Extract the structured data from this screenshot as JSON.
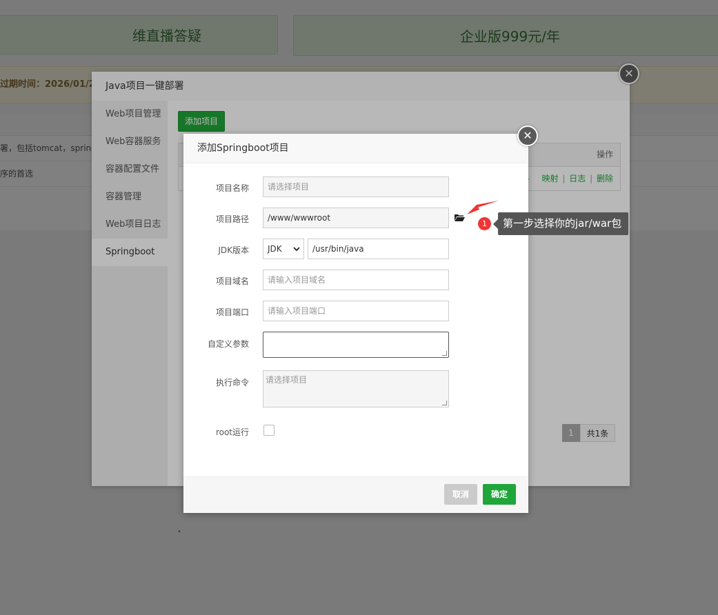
{
  "background": {
    "banner_left": "维直播答疑",
    "banner_right": "企业版999元/年",
    "expire_text": "过期时间：2026/01/2",
    "rows": [
      "署，包括tomcat，spring",
      "序的首选"
    ],
    "bullet": "•"
  },
  "java_modal": {
    "title": "Java项目一键部署",
    "sidebar": [
      {
        "label": "Web项目管理"
      },
      {
        "label": "Web容器服务"
      },
      {
        "label": "容器配置文件"
      },
      {
        "label": "容器管理"
      },
      {
        "label": "Web项目日志"
      },
      {
        "label": "Springboot"
      }
    ],
    "active_index": 5,
    "add_button": "添加项目",
    "table": {
      "header_action": "操作",
      "row_actions": [
        "映射",
        "日志",
        "删除"
      ],
      "separator": "|",
      "play_icon": "▶"
    },
    "pager": {
      "current": "1",
      "total": "共1条"
    },
    "close_icon": "✕"
  },
  "springboot_modal": {
    "title": "添加Springboot项目",
    "close_icon": "✕",
    "fields": {
      "name": {
        "label": "项目名称",
        "placeholder": "请选择项目"
      },
      "path": {
        "label": "项目路径",
        "value": "/www/wwwroot"
      },
      "jdk": {
        "label": "JDK版本",
        "select_value": "JDK",
        "path_value": "/usr/bin/java"
      },
      "domain": {
        "label": "项目域名",
        "placeholder": "请输入项目域名"
      },
      "port": {
        "label": "项目端口",
        "placeholder": "请输入项目端口"
      },
      "args": {
        "label": "自定义参数",
        "value": ""
      },
      "command": {
        "label": "执行命令",
        "placeholder": "请选择项目"
      },
      "root": {
        "label": "root运行"
      }
    },
    "cancel": "取消",
    "confirm": "确定"
  },
  "tooltip": {
    "badge": "1",
    "text": "第一步选择你的jar/war包",
    "arrow_color": "#f03535"
  }
}
